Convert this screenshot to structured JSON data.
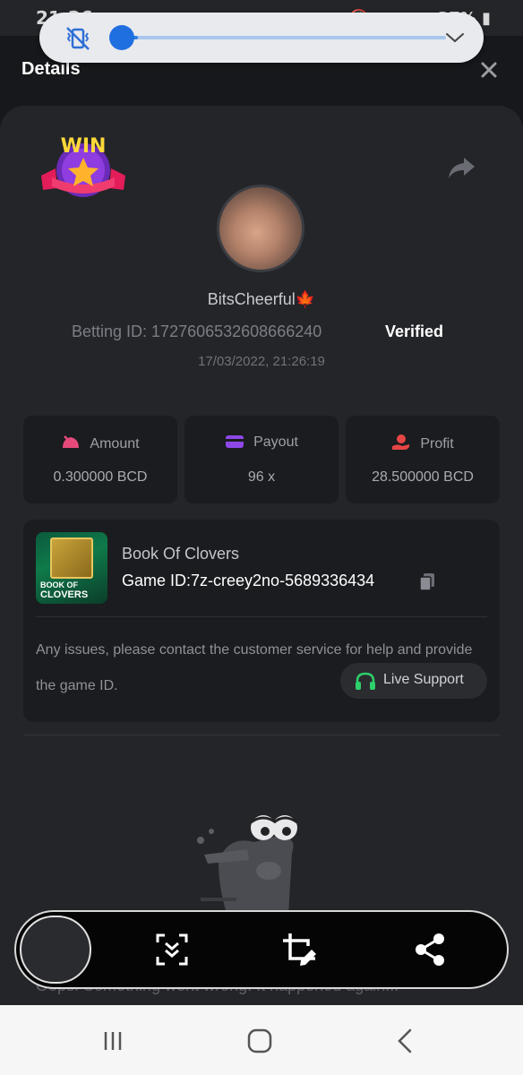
{
  "status_bar": {
    "time": "21:26",
    "battery": "37%"
  },
  "header": {
    "title": "Details"
  },
  "volume": {
    "level_percent": 5
  },
  "bet": {
    "username": "BitsCheerful🍁",
    "betting_id_label": "Betting ID:",
    "betting_id": "1727606532608666240",
    "betting_id_full": "Betting ID: 1727606532608666240",
    "verified_label": "Verified",
    "datetime": "17/03/2022, 21:26:19"
  },
  "stats": [
    {
      "label": "Amount",
      "value": "0.300000 BCD",
      "icon": "amount-icon",
      "color": "#e64a7b"
    },
    {
      "label": "Payout",
      "value": "96 x",
      "icon": "card-icon",
      "color": "#8e48e8"
    },
    {
      "label": "Profit",
      "value": "28.500000 BCD",
      "icon": "hand-coin-icon",
      "color": "#e64545"
    }
  ],
  "game": {
    "name": "Book Of Clovers",
    "id_label": "Game ID:",
    "id": "7z-creey2no-5689336434",
    "id_full": "Game ID:7z-creey2no-5689336434",
    "thumb_line1": "BOOK OF",
    "thumb_line2": "CLOVERS",
    "issue_text": "Any issues, please contact the customer service for help and provide the game ID.",
    "live_support_label": "Live Support"
  },
  "bottom_text": "Oops! Something went wrong. It happened again..."
}
